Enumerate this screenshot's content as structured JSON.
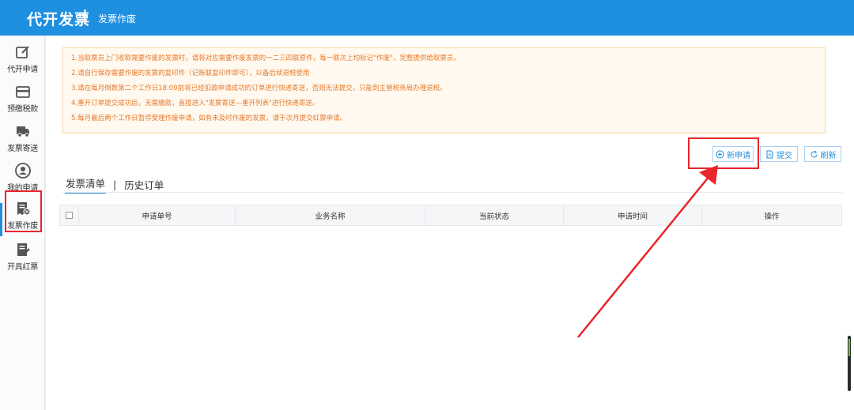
{
  "header": {
    "app_title": "代开发票",
    "separator": "|",
    "page_title": "发票作废"
  },
  "sidebar": {
    "items": [
      {
        "label": "代开申请",
        "icon": "edit-icon"
      },
      {
        "label": "预缴税款",
        "icon": "card-icon"
      },
      {
        "label": "发票寄送",
        "icon": "truck-icon"
      },
      {
        "label": "我的申请",
        "icon": "user-icon"
      },
      {
        "label": "发票作废",
        "icon": "void-invoice-icon",
        "active": true
      },
      {
        "label": "开具红票",
        "icon": "red-invoice-icon"
      }
    ]
  },
  "notice": {
    "lines": [
      "1.当取票员上门收取需要作废的发票时，请将对应需要作废发票的一二三四联原件，每一联次上均标记\"作废\"，完整提供给取票员。",
      "2.请自行保存需要作废的发票的复印件（记账联复印件即可），以备后续退税使用",
      "3.请在每月倒数第二个工作日18:00前将已经扣款申请成功的订单进行快递寄送，否则无法提交，只能到主管税务局办理退税。",
      "4.重开订单提交成功后，无需缴款，直接进入\"发票寄送—重开列表\"进行快递寄送。",
      "5.每月最后两个工作日暂停受理作废申请，如有未及时作废的发票，请于次月提交红票申请。"
    ]
  },
  "toolbar": {
    "new_label": "新申请",
    "submit_label": "提交",
    "refresh_label": "刷新"
  },
  "tabs": {
    "invoice_list": "发票清单",
    "separator": "|",
    "history": "历史订单"
  },
  "table": {
    "columns": [
      "申请单号",
      "业务名称",
      "当前状态",
      "申请时间",
      "操作"
    ]
  },
  "colors": {
    "brand": "#1f8fe0",
    "notice_text": "#e8782a",
    "highlight": "#e8262b"
  }
}
